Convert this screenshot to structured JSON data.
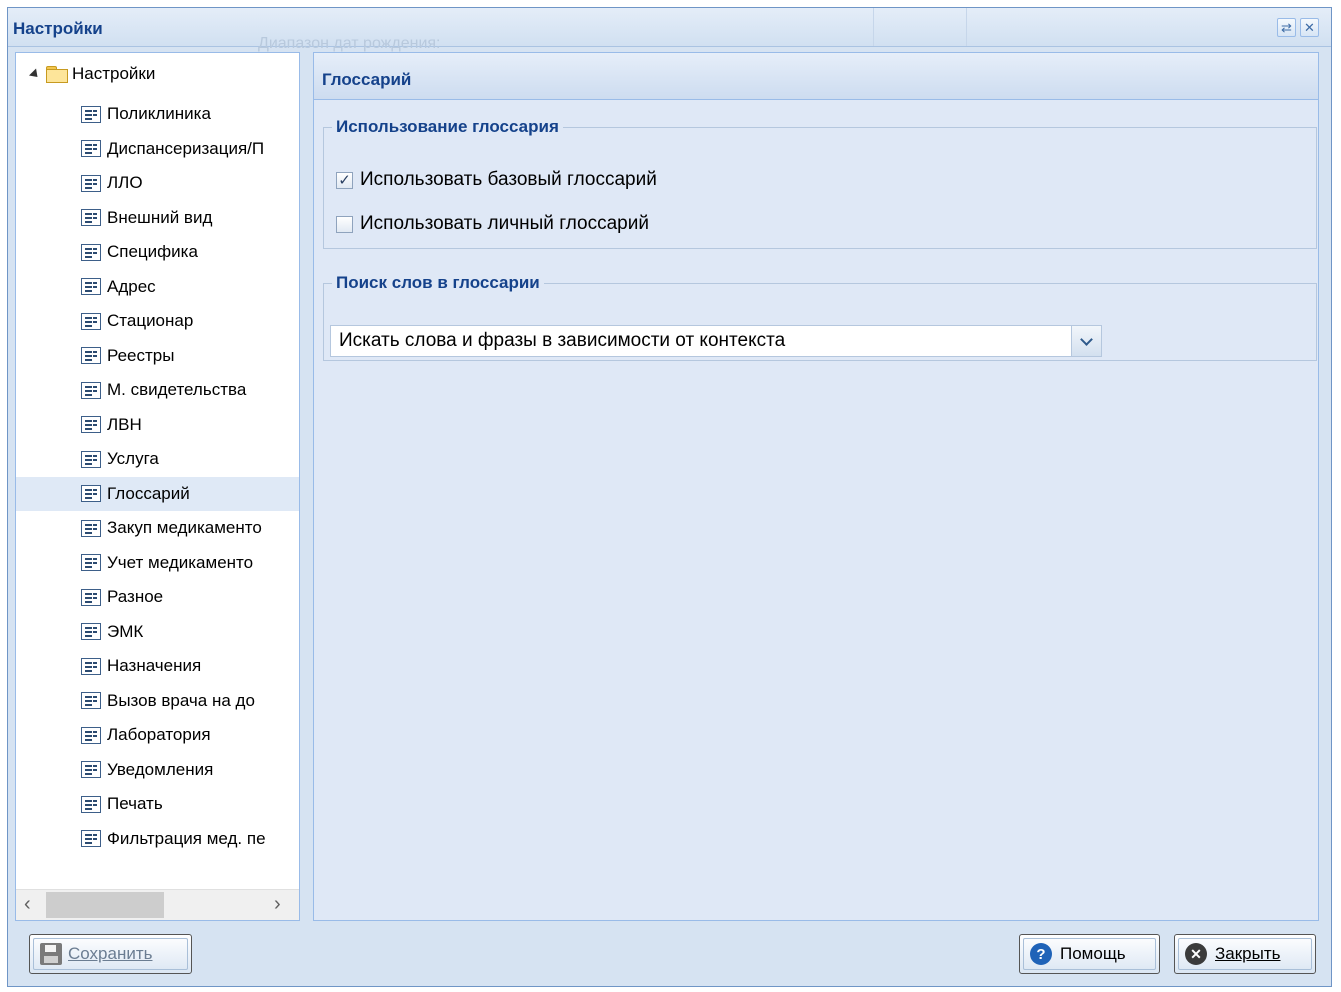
{
  "window": {
    "title": "Настройки",
    "background_hint": "Диапазон дат рождения:",
    "tool_refresh_icon": "⇄",
    "tool_close_icon": "✕"
  },
  "tree": {
    "root_label": "Настройки",
    "items": [
      {
        "label": "Поликлиника"
      },
      {
        "label": "Диспансеризация/П"
      },
      {
        "label": "ЛЛО"
      },
      {
        "label": "Внешний вид"
      },
      {
        "label": "Специфика"
      },
      {
        "label": "Адрес"
      },
      {
        "label": "Стационар"
      },
      {
        "label": "Реестры"
      },
      {
        "label": "М. свидетельства"
      },
      {
        "label": "ЛВН"
      },
      {
        "label": "Услуга"
      },
      {
        "label": "Глоссарий",
        "selected": true
      },
      {
        "label": "Закуп медикаменто"
      },
      {
        "label": "Учет медикаменто"
      },
      {
        "label": "Разное"
      },
      {
        "label": "ЭМК"
      },
      {
        "label": "Назначения"
      },
      {
        "label": "Вызов врача на до"
      },
      {
        "label": "Лаборатория"
      },
      {
        "label": "Уведомления"
      },
      {
        "label": "Печать"
      },
      {
        "label": "Фильтрация мед. пе"
      }
    ]
  },
  "main": {
    "header": "Глоссарий",
    "usage": {
      "legend": "Использование глоссария",
      "use_base": {
        "label": "Использовать базовый глоссарий",
        "checked": true
      },
      "use_personal": {
        "label": "Использовать личный глоссарий",
        "checked": false
      }
    },
    "search": {
      "legend": "Поиск слов в глоссарии",
      "value": "Искать слова и фразы в зависимости от контекста"
    }
  },
  "footer": {
    "save_label": "Сохранить",
    "help_label": "Помощь",
    "close_label": "Закрыть"
  }
}
